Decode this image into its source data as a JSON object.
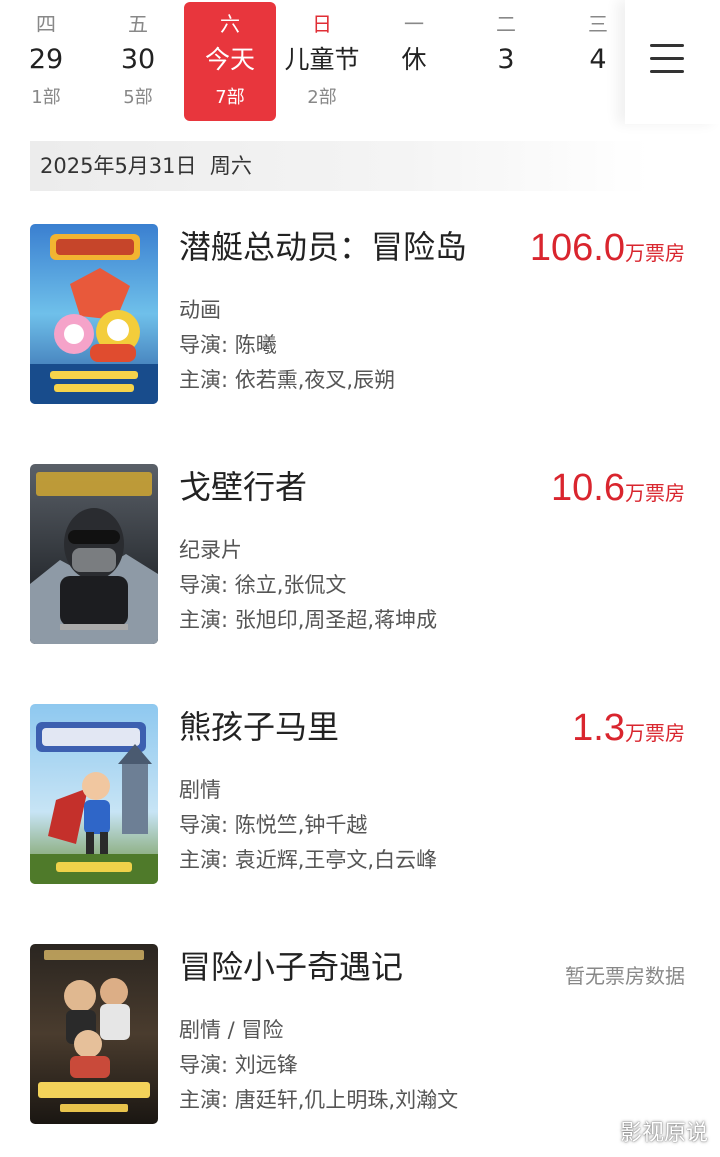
{
  "date_strip": [
    {
      "weekday": "四",
      "day": "29",
      "count": "1部"
    },
    {
      "weekday": "五",
      "day": "30",
      "count": "5部"
    },
    {
      "weekday": "六",
      "day": "今天",
      "count": "7部"
    },
    {
      "weekday": "日",
      "day": "儿童节",
      "count": "2部"
    },
    {
      "weekday": "一",
      "day": "休",
      "count": ""
    },
    {
      "weekday": "二",
      "day": "3",
      "count": ""
    },
    {
      "weekday": "三",
      "day": "4",
      "count": ""
    }
  ],
  "date_bar": {
    "text": "2025年5月31日  周六"
  },
  "movies": [
    {
      "title": "潜艇总动员：冒险岛",
      "box_amount": "106.0",
      "box_unit": "万票房",
      "genre": "动画",
      "director": "导演: 陈曦",
      "cast": "主演: 依若熏,夜叉,辰朔"
    },
    {
      "title": "戈壁行者",
      "box_amount": "10.6",
      "box_unit": "万票房",
      "genre": "纪录片",
      "director": "导演: 徐立,张侃文",
      "cast": "主演: 张旭印,周圣超,蒋坤成"
    },
    {
      "title": "熊孩子马里",
      "box_amount": "1.3",
      "box_unit": "万票房",
      "genre": "剧情",
      "director": "导演: 陈悦竺,钟千越",
      "cast": "主演: 袁近辉,王亭文,白云峰"
    },
    {
      "title": "冒险小子奇遇记",
      "no_box": "暂无票房数据",
      "genre": "剧情 / 冒险",
      "director": "导演: 刘远锋",
      "cast": "主演: 唐廷轩,仉上明珠,刘瀚文"
    }
  ],
  "watermark": "影视原说",
  "colors": {
    "accent": "#e8363d",
    "box_office": "#d9252e",
    "holiday": "#e02e35"
  },
  "icons": {
    "menu": "hamburger-menu-icon"
  }
}
